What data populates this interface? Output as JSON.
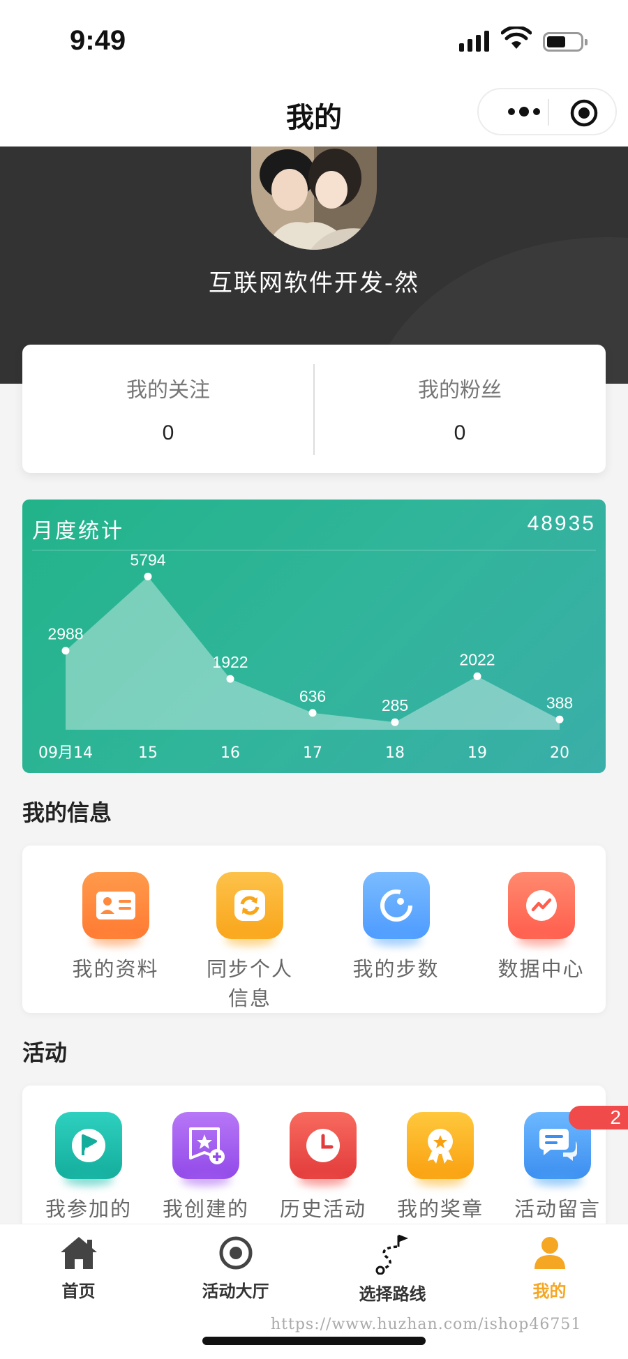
{
  "status_bar": {
    "time": "9:49"
  },
  "nav": {
    "title": "我的"
  },
  "profile": {
    "username": "互联网软件开发-然"
  },
  "follow": {
    "following_label": "我的关注",
    "following_count": "0",
    "fans_label": "我的粉丝",
    "fans_count": "0"
  },
  "monthly": {
    "title": "月度统计",
    "total": "48935"
  },
  "chart_data": {
    "type": "area",
    "categories": [
      "09月14",
      "15",
      "16",
      "17",
      "18",
      "19",
      "20"
    ],
    "values": [
      2988,
      5794,
      1922,
      636,
      285,
      2022,
      388
    ],
    "ylim": [
      0,
      6200
    ],
    "grid": false
  },
  "my_info": {
    "title": "我的信息",
    "items": [
      {
        "label": "我的资料",
        "icon": "profile-card-icon",
        "color": "#ff8a3d"
      },
      {
        "label": "同步个人信息",
        "icon": "sync-icon",
        "color": "#fbb22c"
      },
      {
        "label": "我的步数",
        "icon": "steps-icon",
        "color": "#5aa7ff"
      },
      {
        "label": "数据中心",
        "icon": "data-center-icon",
        "color": "#ff6f5c"
      }
    ]
  },
  "activity": {
    "title": "活动",
    "items": [
      {
        "label": "我参加的",
        "icon": "flag-icon",
        "color": "#1fbfae"
      },
      {
        "label": "我创建的",
        "icon": "create-star-icon",
        "color": "#a65ff0"
      },
      {
        "label": "历史活动",
        "icon": "clock-icon",
        "color": "#f0504a"
      },
      {
        "label": "我的奖章",
        "icon": "medal-icon",
        "color": "#fbb020"
      },
      {
        "label": "活动留言",
        "icon": "chat-bubble-icon",
        "color": "#4aa3f5"
      }
    ],
    "message_badge": "2"
  },
  "tabbar": {
    "items": [
      {
        "label": "首页",
        "icon": "home-icon"
      },
      {
        "label": "活动大厅",
        "icon": "target-icon"
      },
      {
        "label": "选择路线",
        "icon": "route-icon"
      },
      {
        "label": "我的",
        "icon": "user-icon"
      }
    ],
    "active_color": "#f5a623"
  },
  "watermark": "https://www.huzhan.com/ishop46751"
}
